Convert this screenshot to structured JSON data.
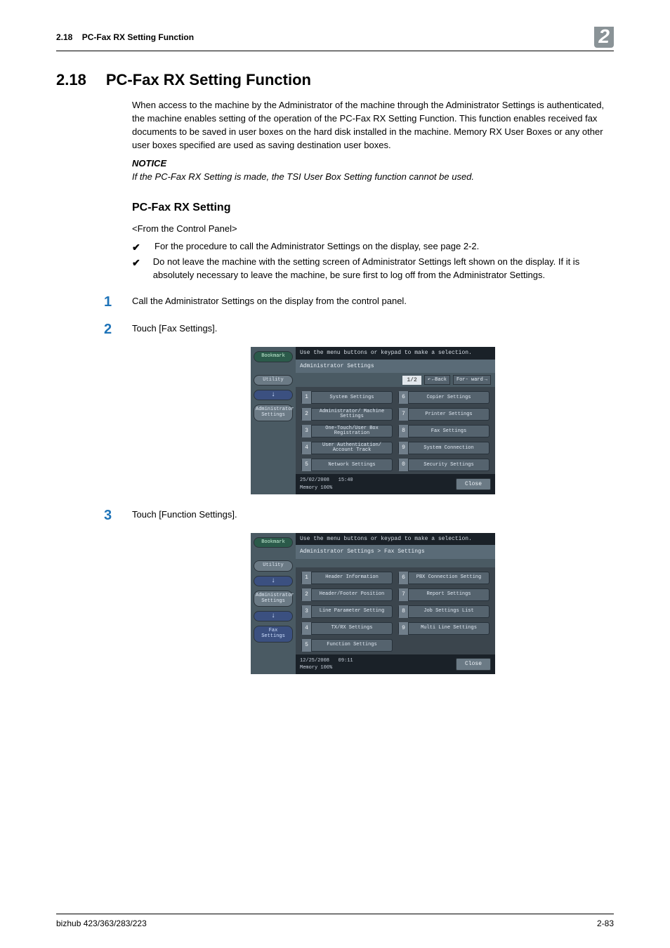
{
  "header": {
    "section_num": "2.18",
    "section_title_short": "PC-Fax RX Setting Function",
    "chapter_badge": "2"
  },
  "h1": {
    "num": "2.18",
    "title": "PC-Fax RX Setting Function"
  },
  "intro": "When access to the machine by the Administrator of the machine through the Administrator Settings is authenticated, the machine enables setting of the operation of the PC-Fax RX Setting Function. This function enables received fax documents to be saved in user boxes on the hard disk installed in the machine. Memory RX User Boxes or any other user boxes specified are used as saving destination user boxes.",
  "notice": {
    "label": "NOTICE",
    "text": "If the PC-Fax RX Setting is made, the TSI User Box Setting function cannot be used."
  },
  "h2": "PC-Fax RX Setting",
  "from_panel": "<From the Control Panel>",
  "checks": [
    "For the procedure to call the Administrator Settings on the display, see page 2-2.",
    "Do not leave the machine with the setting screen of Administrator Settings left shown on the display. If it is absolutely necessary to leave the machine, be sure first to log off from the Administrator Settings."
  ],
  "steps": [
    {
      "num": "1",
      "text": "Call the Administrator Settings on the display from the control panel."
    },
    {
      "num": "2",
      "text": "Touch [Fax Settings]."
    },
    {
      "num": "3",
      "text": "Touch [Function Settings]."
    }
  ],
  "panel_common": {
    "top_hint": "Use the menu buttons or keypad to make a selection.",
    "close": "Close",
    "bookmark": "Bookmark",
    "utility": "Utility",
    "admin": "Administrator Settings",
    "fax_settings_nav": "Fax Settings",
    "back": "←Back",
    "fwd": "For-\nward"
  },
  "panel1": {
    "crumb": "Administrator Settings",
    "page": "1/2",
    "status_date": "25/02/2008",
    "status_time": "15:40",
    "status_mem": "Memory     100%",
    "left": [
      {
        "n": "1",
        "label": "System Settings"
      },
      {
        "n": "2",
        "label": "Administrator/\nMachine Settings"
      },
      {
        "n": "3",
        "label": "One-Touch/User Box\nRegistration"
      },
      {
        "n": "4",
        "label": "User Authentication/\nAccount Track"
      },
      {
        "n": "5",
        "label": "Network Settings"
      }
    ],
    "right": [
      {
        "n": "6",
        "label": "Copier Settings"
      },
      {
        "n": "7",
        "label": "Printer Settings"
      },
      {
        "n": "8",
        "label": "Fax Settings"
      },
      {
        "n": "9",
        "label": "System Connection"
      },
      {
        "n": "0",
        "label": "Security Settings"
      }
    ]
  },
  "panel2": {
    "crumb": "Administrator Settings  > Fax Settings",
    "status_date": "12/25/2008",
    "status_time": "09:11",
    "status_mem": "Memory     100%",
    "left": [
      {
        "n": "1",
        "label": "Header\nInformation"
      },
      {
        "n": "2",
        "label": "Header/Footer\nPosition"
      },
      {
        "n": "3",
        "label": "Line Parameter Setting"
      },
      {
        "n": "4",
        "label": "TX/RX Settings"
      },
      {
        "n": "5",
        "label": "Function Settings"
      }
    ],
    "right": [
      {
        "n": "6",
        "label": "PBX Connection\nSetting"
      },
      {
        "n": "7",
        "label": "Report Settings"
      },
      {
        "n": "8",
        "label": "Job Settings\nList"
      },
      {
        "n": "9",
        "label": "Multi Line\nSettings"
      }
    ]
  },
  "footer": {
    "left": "bizhub 423/363/283/223",
    "right": "2-83"
  }
}
